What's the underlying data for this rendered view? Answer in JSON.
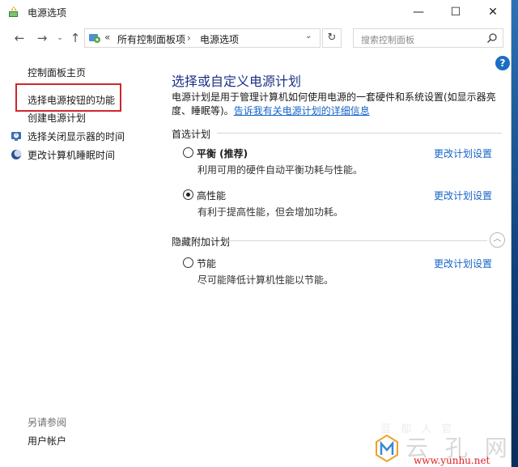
{
  "window": {
    "title": "电源选项",
    "minimize": "—",
    "maximize": "☐",
    "close": "✕"
  },
  "nav": {
    "back": "←",
    "forward": "→",
    "history": "⌄",
    "up": "↑",
    "address_chevron": "«",
    "breadcrumbs": [
      "所有控制面板项",
      "电源选项"
    ],
    "separator": "›",
    "dropdown": "⌄",
    "refresh": "↻",
    "search_placeholder": "搜索控制面板"
  },
  "sidebar": {
    "home": "控制面板主页",
    "items": [
      "选择电源按钮的功能",
      "创建电源计划",
      "选择关闭显示器的时间",
      "更改计算机睡眠时间"
    ],
    "see_also_title": "另请参阅",
    "see_also": [
      "用户帐户"
    ]
  },
  "main": {
    "help": "?",
    "heading": "选择或自定义电源计划",
    "description": "电源计划是用于管理计算机如何使用电源的一套硬件和系统设置(如显示器亮度、睡眠等)。",
    "description_link": "告诉我有关电源计划的详细信息",
    "preferred_group": "首选计划",
    "hidden_group": "隐藏附加计划",
    "collapse": "︿",
    "plans": [
      {
        "name": "平衡 (推荐)",
        "desc": "利用可用的硬件自动平衡功耗与性能。",
        "link": "更改计划设置",
        "checked": false
      },
      {
        "name": "高性能",
        "desc": "有利于提高性能，但会增加功耗。",
        "link": "更改计划设置",
        "checked": true
      },
      {
        "name": "节能",
        "desc": "尽可能降低计算机性能以节能。",
        "link": "更改计划设置",
        "checked": false
      }
    ]
  },
  "watermark": {
    "text": "云 孔 网",
    "url": "www.yunhu.net",
    "faint": "蓝 都 人 官"
  },
  "colors": {
    "heading": "#1e3287",
    "link": "#1764c8",
    "highlight": "#d0262b",
    "help": "#1b6ec2"
  }
}
